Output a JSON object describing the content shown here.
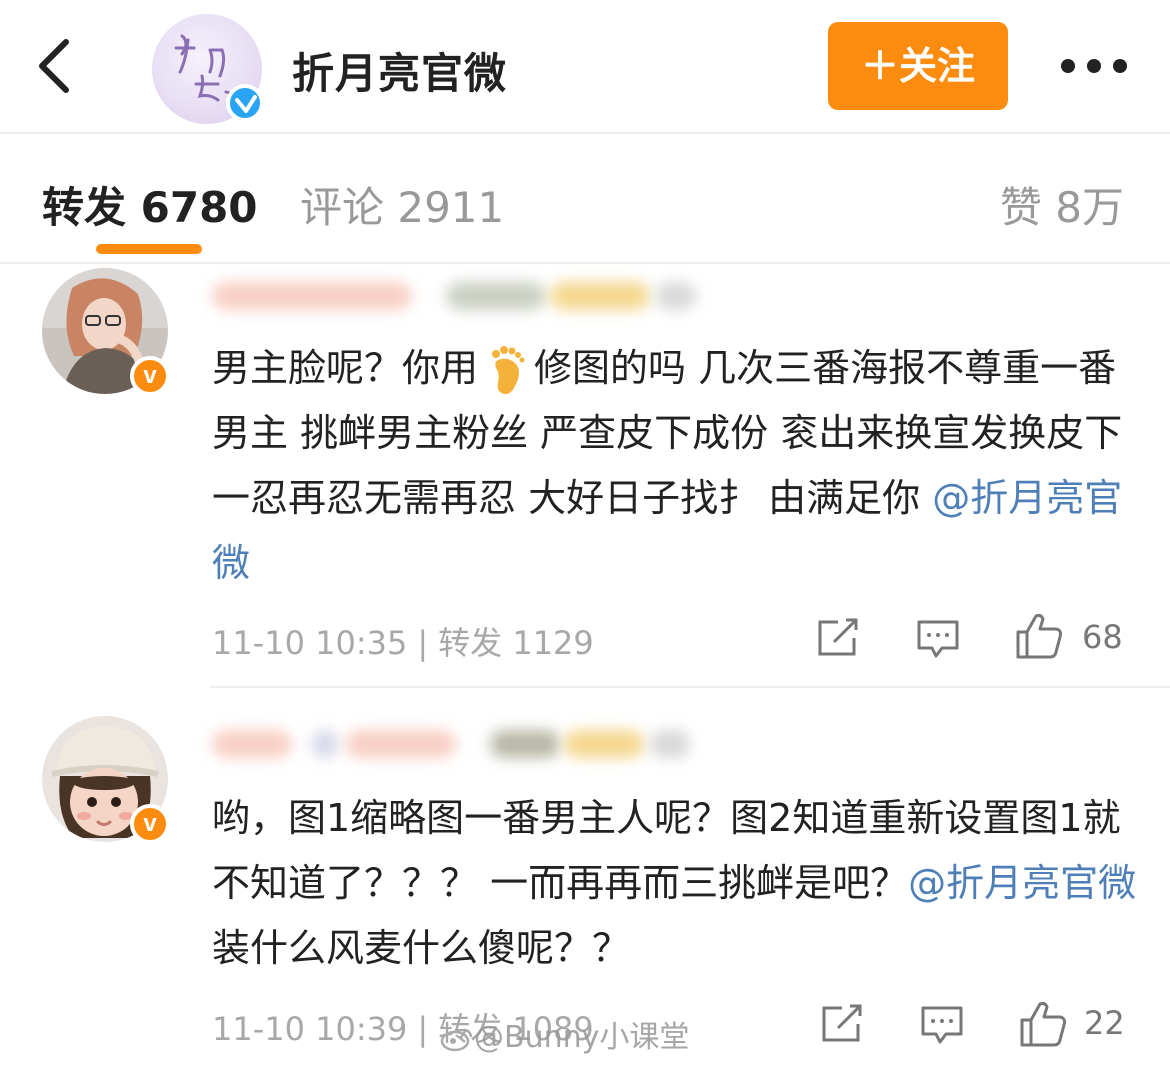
{
  "header": {
    "account_name": "折月亮官微",
    "avatar_text": "折月亮",
    "follow_label": "＋关注",
    "back_icon": "chevron-left-icon",
    "more_icon": "more-dots-icon"
  },
  "tabs": {
    "repost": "转发 6780",
    "comment": "评论 2911",
    "like": "赞 8万"
  },
  "posts": [
    {
      "text_before": "男主脸呢？你用",
      "emoji": "foot",
      "text_after": "修图的吗 几次三番海报不尊重一番男主 挑衅男主粉丝 严查皮下成份 衮出来换宣发换皮下 一忍再忍无需再忍 大好日子找扌 由满足你 ",
      "mention": "@折月亮官微",
      "tail": "",
      "time": "11-10 10:35",
      "repost": "转发 1129",
      "like_count": "68"
    },
    {
      "text_before": "哟，图1缩略图一番男主人呢？图2知道重新设置图1就不知道了？？？ 一而再再而三挑衅是吧？",
      "mention": "@折月亮官微",
      "tail": " 装什么风麦什么傻呢？？",
      "time": "11-10 10:39",
      "repost": "转发 1089",
      "like_count": "22"
    }
  ],
  "watermark": "@Bunny小课堂",
  "colors": {
    "accent": "#fc8c10",
    "mention": "#4e7fb7",
    "verified_blue": "#2aa4f4",
    "muted": "#a8a8a8"
  }
}
